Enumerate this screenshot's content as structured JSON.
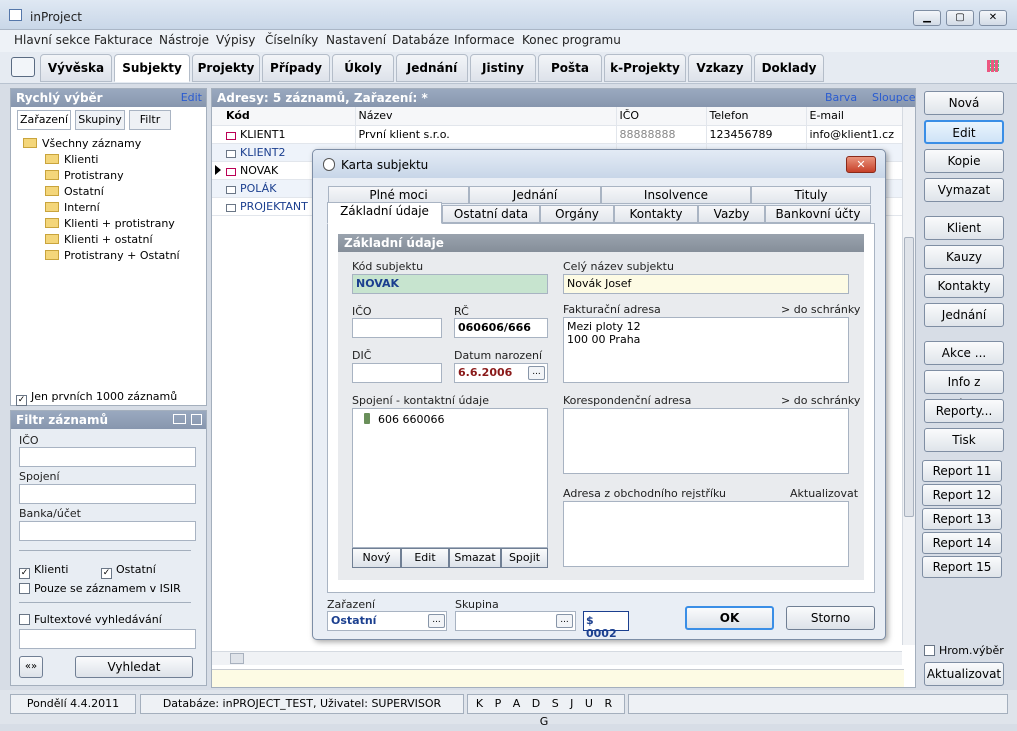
{
  "window": {
    "title": "inProject"
  },
  "menu": [
    "Hlavní sekce",
    "Fakturace",
    "Nástroje",
    "Výpisy",
    "Číselníky",
    "Nastavení",
    "Databáze",
    "Informace",
    "Konec programu"
  ],
  "tabs": [
    "Vývěska",
    "Subjekty",
    "Projekty",
    "Případy",
    "Úkoly",
    "Jednání",
    "Jistiny",
    "Pošta",
    "k-Projekty",
    "Vzkazy",
    "Doklady"
  ],
  "quick": {
    "title": "Rychlý výběr",
    "edit": "Edit",
    "tabs": [
      "Zařazení",
      "Skupiny",
      "Filtr"
    ],
    "tree_root": "Všechny záznamy",
    "tree": [
      "Klienti",
      "Protistrany",
      "Ostatní",
      "Interní",
      "Klienti + protistrany",
      "Klienti + ostatní",
      "Protistrany + Ostatní"
    ],
    "limit": "Jen prvních 1000 záznamů"
  },
  "filter": {
    "title": "Filtr záznamů",
    "ico": "IČO",
    "spojeni": "Spojení",
    "banka": "Banka/účet",
    "klienti": "Klienti",
    "ostatni": "Ostatní",
    "isir": "Pouze se záznamem v ISIR",
    "fulltext": "Fultextové vyhledávání",
    "toggle": "«»",
    "search": "Vyhledat"
  },
  "list": {
    "header": "Adresy: 5 záznamů, Zařazení: *",
    "barva": "Barva",
    "sloupce": "Sloupce",
    "columns": [
      "Kód",
      "Název",
      "IČO",
      "Telefon",
      "E-mail"
    ],
    "rows": [
      [
        "KLIENT1",
        "První klient s.r.o.",
        "88888888",
        "123456789",
        "info@klient1.cz"
      ],
      [
        "KLIENT2",
        "",
        "",
        "",
        ""
      ],
      [
        "NOVAK",
        "",
        "",
        "",
        ""
      ],
      [
        "POLÁK",
        "",
        "",
        "",
        ""
      ],
      [
        "PROJEKTANT",
        "",
        "",
        "",
        ""
      ]
    ]
  },
  "right": {
    "buttons": [
      "Nová",
      "Edit",
      "Kopie",
      "Vymazat"
    ],
    "buttons2": [
      "Klient",
      "Kauzy",
      "Kontakty",
      "Jednání"
    ],
    "buttons3": [
      "Akce ...",
      "Info z webu...",
      "Reporty...",
      "Tisk"
    ],
    "reports": [
      "Report 11",
      "Report 12",
      "Report 13",
      "Report 14",
      "Report 15"
    ],
    "hrom": "Hrom.výběr",
    "refresh": "Aktualizovat"
  },
  "dialog": {
    "title": "Karta subjektu",
    "tabs_back": [
      "Plné moci",
      "Jednání",
      "Insolvence",
      "Tituly"
    ],
    "tabs_front": [
      "Základní údaje",
      "Ostatní data",
      "Orgány",
      "Kontakty",
      "Vazby",
      "Bankovní účty"
    ],
    "section": "Základní údaje",
    "kod_label": "Kód subjektu",
    "kod": "NOVAK",
    "nazev_label": "Celý název subjektu",
    "nazev": "Novák Josef",
    "ico_label": "IČO",
    "ico": "",
    "rc_label": "RČ",
    "rc": "060606/666",
    "dic_label": "DIČ",
    "dic": "",
    "datum_label": "Datum narození",
    "datum": "6.6.2006",
    "fakt_label": "Fakturační adresa",
    "do_schranky": "> do schránky",
    "fakt": [
      "Mezi ploty 12",
      "100 00 Praha"
    ],
    "spoj_label": "Spojení - kontaktní údaje",
    "phone": "606 660066",
    "kor_label": "Korespondenční adresa",
    "or_label": "Adresa z obchodního rejstříku",
    "aktualizovat": "Aktualizovat",
    "list_btns": [
      "Nový",
      "Edit",
      "Smazat",
      "Spojit"
    ],
    "zarazeni_label": "Zařazení",
    "zarazeni": "Ostatní",
    "skupina_label": "Skupina",
    "num": "$ 0002",
    "ok": "OK",
    "storno": "Storno",
    "dots": "..."
  },
  "status": {
    "date": "Pondělí 4.4.2011",
    "db": "Databáze: inPROJECT_TEST, Uživatel: SUPERVISOR",
    "letters": "K P A D S J U R G"
  }
}
